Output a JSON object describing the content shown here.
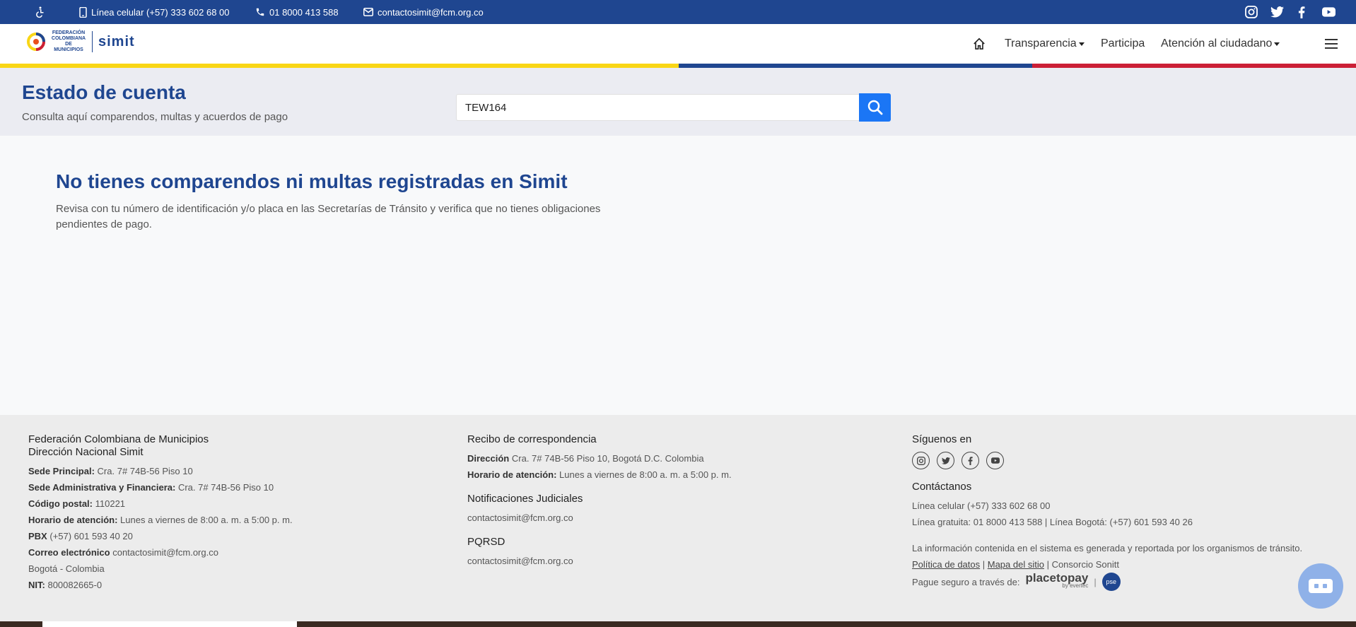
{
  "topbar": {
    "phone_mobile": "Línea celular (+57) 333 602 68 00",
    "phone_free": "01 8000 413 588",
    "email": "contactosimit@fcm.org.co",
    "social_icons": [
      "instagram-icon",
      "twitter-icon",
      "facebook-icon",
      "youtube-icon"
    ]
  },
  "header": {
    "logo_text": "FEDERACIÓN COLOMBIANA DE MUNICIPIOS",
    "logo_brand": "simit",
    "nav": {
      "transparencia": "Transparencia",
      "participa": "Participa",
      "atencion": "Atención al ciudadano"
    }
  },
  "search": {
    "title": "Estado de cuenta",
    "subtitle": "Consulta aquí comparendos, multas y acuerdos de pago",
    "value": "TEW164"
  },
  "result": {
    "title": "No tienes comparendos ni multas registradas en Simit",
    "text": "Revisa con tu número de identificación y/o placa en las Secretarías de Tránsito y verifica que no tienes obligaciones pendientes de pago."
  },
  "footer": {
    "col1": {
      "title1": "Federación Colombiana de Municipios",
      "title2": "Dirección Nacional Simit",
      "sede_label": "Sede Principal:",
      "sede_value": "Cra. 7# 74B-56 Piso 10",
      "adm_label": "Sede Administrativa y Financiera:",
      "adm_value": "Cra. 7# 74B-56 Piso 10",
      "cp_label": "Código postal:",
      "cp_value": "110221",
      "horario_label": "Horario de atención:",
      "horario_value": "Lunes a viernes de 8:00 a. m. a 5:00 p. m.",
      "pbx_label": "PBX",
      "pbx_value": "(+57) 601 593 40 20",
      "correo_label": "Correo electrónico",
      "correo_value": "contactosimit@fcm.org.co",
      "city": "Bogotá - Colombia",
      "nit_label": "NIT:",
      "nit_value": "800082665-0"
    },
    "col2": {
      "recibo_title": "Recibo de correspondencia",
      "dir_label": "Dirección",
      "dir_value": "Cra. 7# 74B-56 Piso 10, Bogotá D.C. Colombia",
      "horario_label": "Horario de atención:",
      "horario_value": "Lunes a viernes de 8:00 a. m. a 5:00 p. m.",
      "notif_title": "Notificaciones Judiciales",
      "notif_email": "contactosimit@fcm.org.co",
      "pqrsd_title": "PQRSD",
      "pqrsd_email": "contactosimit@fcm.org.co"
    },
    "col3": {
      "follow_title": "Síguenos en",
      "contact_title": "Contáctanos",
      "line1": "Línea celular (+57) 333 602 68 00",
      "line2": "Línea gratuita: 01 8000 413 588 | Línea Bogotá: (+57) 601 593 40 26",
      "info": "La información contenida en el sistema es generada y reportada por los organismos de tránsito.",
      "link_politica": "Política de datos",
      "link_mapa": "Mapa del sitio",
      "consorcio": "Consorcio Sonitt",
      "pague": "Pague seguro a través de:",
      "placetopay": "placetopay",
      "evertec": "by evertec",
      "pse": "pse"
    }
  }
}
